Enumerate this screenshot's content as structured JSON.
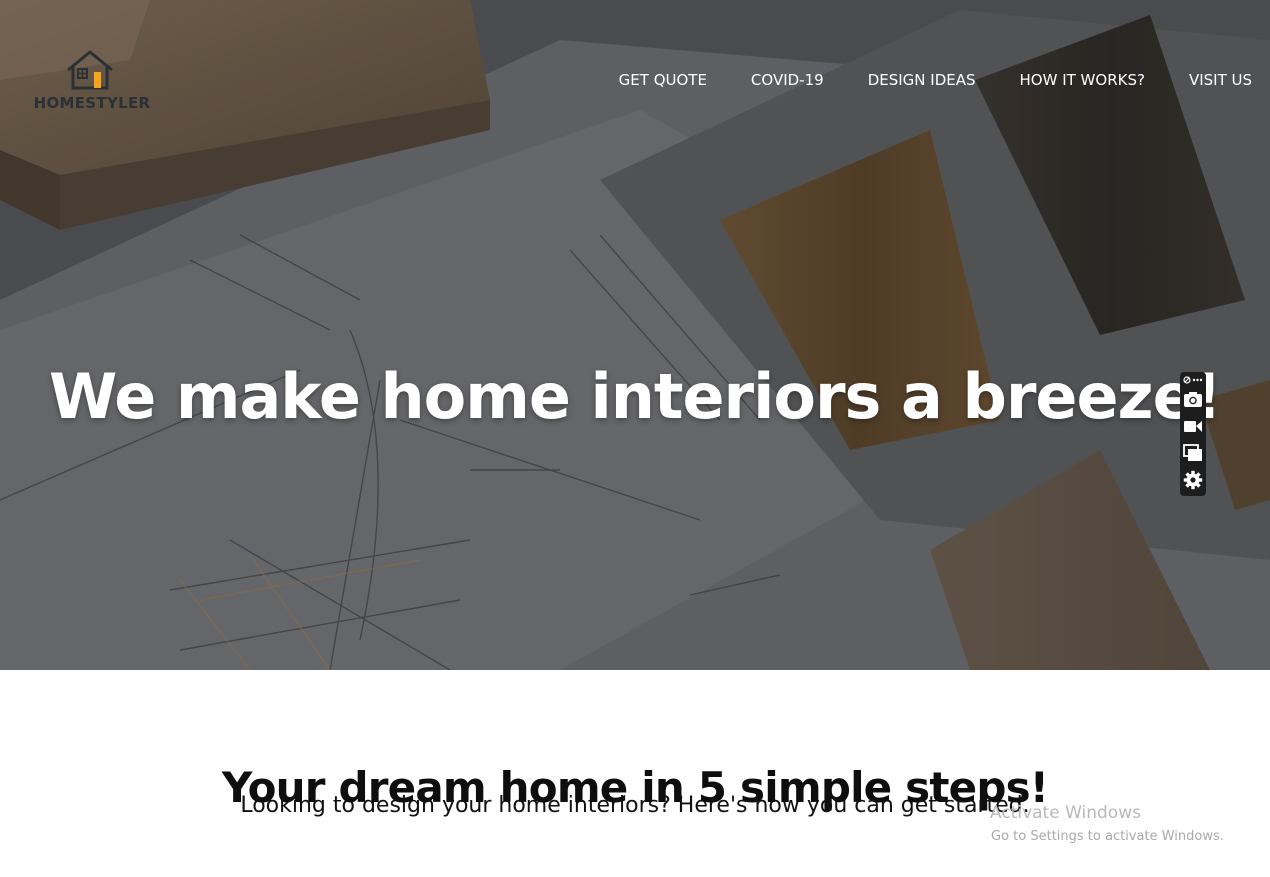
{
  "brand": {
    "name": "HOMESTYLER",
    "accent_color": "#f7a41d",
    "ink_color": "#2b3036"
  },
  "nav": {
    "items": [
      {
        "label": "GET QUOTE"
      },
      {
        "label": "COVID-19"
      },
      {
        "label": "DESIGN IDEAS"
      },
      {
        "label": "HOW IT WORKS?"
      },
      {
        "label": "VISIT US"
      }
    ]
  },
  "hero": {
    "headline": "We make home interiors a breeze!",
    "background": "architectural sketches with wood veneer samples"
  },
  "floating_toolbar": {
    "tools": [
      {
        "icon": "more-icon"
      },
      {
        "icon": "camera-icon"
      },
      {
        "icon": "video-icon"
      },
      {
        "icon": "screens-icon"
      },
      {
        "icon": "gear-icon"
      }
    ]
  },
  "steps": {
    "title": "Your dream home in 5 simple steps!",
    "subtitle": "Looking to design your home interiors? Here's how you can get started."
  },
  "watermark": {
    "title": "Activate Windows",
    "subtitle": "Go to Settings to activate Windows."
  }
}
